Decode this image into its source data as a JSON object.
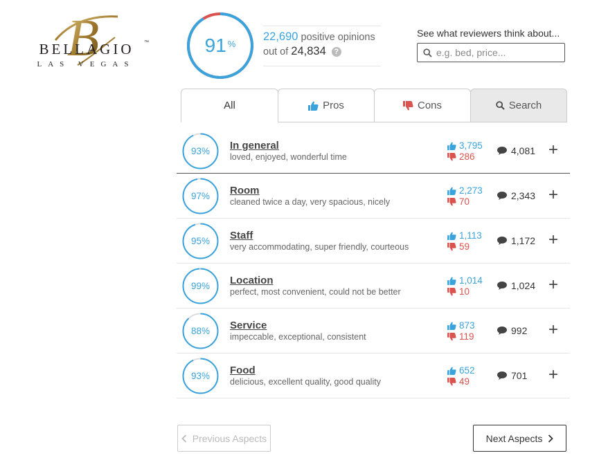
{
  "logo": {
    "brand": "BELLAGIO",
    "trademark": "™",
    "city": "LAS VEGAS",
    "monogram": "B"
  },
  "summary": {
    "score": 91,
    "score_label": "91",
    "score_unit": "%",
    "positive_count": "22,690",
    "positive_text": "positive opinions",
    "out_of_text": "out of",
    "total_count": "24,834",
    "help_glyph": "?"
  },
  "review_search": {
    "label": "See what reviewers think about...",
    "placeholder": "e.g. bed, price..."
  },
  "tabs": [
    {
      "label": "All",
      "icon": "none"
    },
    {
      "label": "Pros",
      "icon": "thumbs-up-icon"
    },
    {
      "label": "Cons",
      "icon": "thumbs-down-icon"
    },
    {
      "label": "Search",
      "icon": "search-icon"
    }
  ],
  "aspects": [
    {
      "score": 93,
      "pct": "93%",
      "name": "In general",
      "desc": "loved, enjoyed, wonderful time",
      "up": "3,795",
      "down": "286",
      "mentions": "4,081"
    },
    {
      "score": 97,
      "pct": "97%",
      "name": "Room",
      "desc": "cleaned twice a day, very spacious, nicely",
      "up": "2,273",
      "down": "70",
      "mentions": "2,343"
    },
    {
      "score": 95,
      "pct": "95%",
      "name": "Staff",
      "desc": "very accommodating, super friendly, courteous",
      "up": "1,113",
      "down": "59",
      "mentions": "1,172"
    },
    {
      "score": 99,
      "pct": "99%",
      "name": "Location",
      "desc": "perfect, most convenient, could not be better",
      "up": "1,014",
      "down": "10",
      "mentions": "1,024"
    },
    {
      "score": 88,
      "pct": "88%",
      "name": "Service",
      "desc": "impeccable, exceptional, consistent",
      "up": "873",
      "down": "119",
      "mentions": "992"
    },
    {
      "score": 93,
      "pct": "93%",
      "name": "Food",
      "desc": "delicious, excellent quality, good quality",
      "up": "652",
      "down": "49",
      "mentions": "701"
    }
  ],
  "expand_glyph": "+",
  "pagination": {
    "prev_label": "Previous Aspects",
    "next_label": "Next Aspects"
  },
  "colors": {
    "accent": "#3aa3dc",
    "negative": "#d9534f",
    "ring_track": "#dddddd",
    "gold": "#b08a3e"
  }
}
